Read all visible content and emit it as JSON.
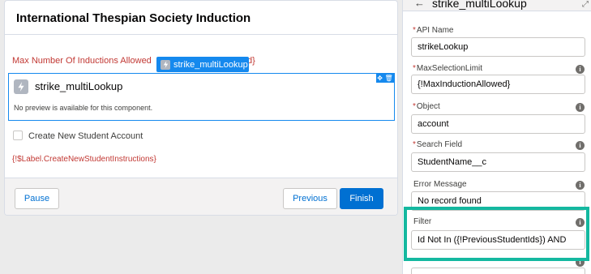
{
  "flow": {
    "title": "International Thespian Society Induction",
    "max_text": "Max Number Of Inductions Allowed",
    "max_suffix": "d}",
    "component_tag": "strike_multiLookup",
    "component_name": "strike_multiLookup",
    "no_preview": "No preview is available for this component.",
    "checkbox_label": "Create New Student Account",
    "instructions_label": "{!$Label.CreateNewStudentInstructions}",
    "buttons": {
      "pause": "Pause",
      "previous": "Previous",
      "finish": "Finish"
    }
  },
  "panel": {
    "title": "strike_multiLookup",
    "fields": [
      {
        "label": "API Name",
        "required": "*",
        "value": "strikeLookup"
      },
      {
        "label": "MaxSelectionLimit",
        "required": "*",
        "value": "{!MaxInductionAllowed}"
      },
      {
        "label": "Object",
        "required": "*",
        "value": "account"
      },
      {
        "label": "Search Field",
        "required": "*",
        "value": "StudentName__c"
      },
      {
        "label": "Error Message",
        "required": "",
        "value": "No record found"
      },
      {
        "label": "Filter",
        "required": "",
        "value": "Id Not In ({!PreviousStudentIds}) AND"
      }
    ]
  },
  "colors": {
    "accent": "#0070d2",
    "selection": "#1589ee",
    "error": "#c23934",
    "highlight": "#14b8a0"
  },
  "icons": {
    "component": "lightning-bolt-icon",
    "back": "arrow-left-icon",
    "info": "info-icon"
  }
}
